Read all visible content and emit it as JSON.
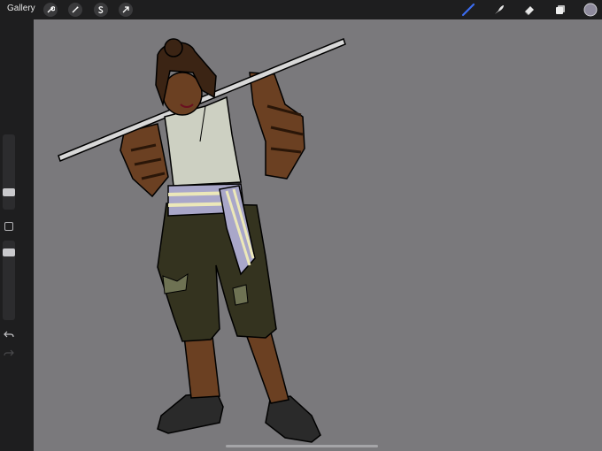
{
  "app": {
    "gallery_label": "Gallery"
  },
  "toolbar": {
    "left_tools": [
      "wrench-icon",
      "magic-wand-icon",
      "selection-s-icon",
      "transform-arrow-icon"
    ],
    "right_tools": [
      "brush-icon",
      "smudge-icon",
      "eraser-icon",
      "layers-icon",
      "color-swatch"
    ],
    "active_tool": "brush-icon",
    "brush_color": "#3b6cf0",
    "current_color": "#8e8a9c"
  },
  "sidebar": {
    "brush_size_level": 0.55,
    "opacity_level": 0.65
  },
  "colors": {
    "canvas_bg": "#7a797c",
    "chrome_bg": "#1e1e1f"
  }
}
